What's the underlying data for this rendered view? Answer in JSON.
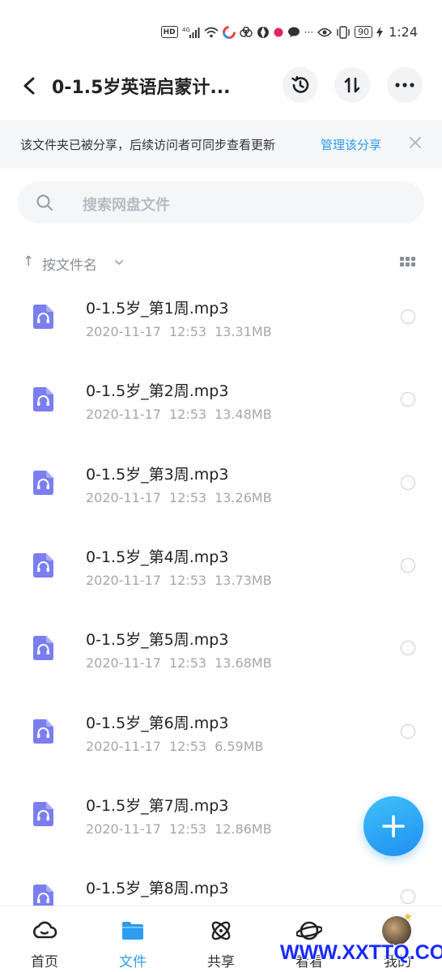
{
  "status_bar": {
    "network": "4G",
    "battery": "90",
    "time": "1:24"
  },
  "header": {
    "title": "0-1.5岁英语启蒙计..."
  },
  "banner": {
    "text": "该文件夹已被分享，后续访问者可同步查看更新",
    "link": "管理该分享"
  },
  "search": {
    "placeholder": "搜索网盘文件"
  },
  "sort": {
    "label": "按文件名"
  },
  "files": [
    {
      "name": "0-1.5岁_第1周.mp3",
      "date": "2020-11-17",
      "time": "12:53",
      "size": "13.31MB"
    },
    {
      "name": "0-1.5岁_第2周.mp3",
      "date": "2020-11-17",
      "time": "12:53",
      "size": "13.48MB"
    },
    {
      "name": "0-1.5岁_第3周.mp3",
      "date": "2020-11-17",
      "time": "12:53",
      "size": "13.26MB"
    },
    {
      "name": "0-1.5岁_第4周.mp3",
      "date": "2020-11-17",
      "time": "12:53",
      "size": "13.73MB"
    },
    {
      "name": "0-1.5岁_第5周.mp3",
      "date": "2020-11-17",
      "time": "12:53",
      "size": "13.68MB"
    },
    {
      "name": "0-1.5岁_第6周.mp3",
      "date": "2020-11-17",
      "time": "12:53",
      "size": "6.59MB"
    },
    {
      "name": "0-1.5岁_第7周.mp3",
      "date": "2020-11-17",
      "time": "12:53",
      "size": "12.86MB"
    },
    {
      "name": "0-1.5岁_第8周.mp3",
      "date": "",
      "time": "",
      "size": ""
    }
  ],
  "nav": {
    "items": [
      {
        "label": "首页"
      },
      {
        "label": "文件"
      },
      {
        "label": "共享"
      },
      {
        "label": "看看"
      },
      {
        "label": "我的"
      }
    ]
  },
  "watermark": "WWW.XXTTQ.COM",
  "colors": {
    "accent": "#2e9cf0",
    "file_icon": "#7b7ef0"
  }
}
